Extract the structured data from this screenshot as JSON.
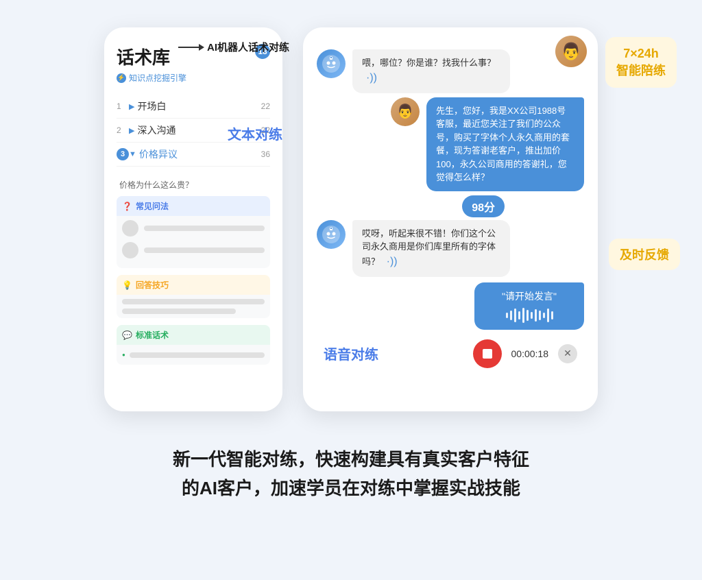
{
  "page": {
    "bg_color": "#f0f4fa"
  },
  "arrow_label": "AI机器人话术对练",
  "phone_left": {
    "title": "话术库",
    "subtitle": "知识点挖掘引擎",
    "badge_count": "18",
    "menu_items": [
      {
        "num": "1",
        "arrow": "▶",
        "label": "开场白",
        "count": "22",
        "active": false
      },
      {
        "num": "2",
        "arrow": "▶",
        "label": "深入沟通",
        "count": "22",
        "active": false
      },
      {
        "num": "3",
        "arrow": "▼",
        "label": "价格异议",
        "count": "36",
        "active": true
      }
    ],
    "sub_question": "价格为什么这么贵？",
    "sections": [
      {
        "type": "faq",
        "icon": "❓",
        "label": "常见问法",
        "color": "blue"
      },
      {
        "type": "tips",
        "icon": "💡",
        "label": "回答技巧",
        "color": "orange"
      },
      {
        "type": "std",
        "icon": "💬",
        "label": "标准话术",
        "color": "green"
      }
    ]
  },
  "phone_right": {
    "header": "AI机器人话术对练",
    "messages": [
      {
        "type": "bot",
        "text": "喂，哪位？你是谁？找我什么事？",
        "has_sound": true
      },
      {
        "type": "user",
        "text": "先生，您好，我是XX公司1988号客服，最近您关注了我们的公众号，购买了字体个人永久商用的套餐，现为答谢老客户，推出加价100，永久公司商用的答谢礼，您觉得怎么样？",
        "has_sound": false
      },
      {
        "type": "bot",
        "text": "哎呀，听起来很不错！你们这个公司永久商用是你们库里所有的字体吗？",
        "has_sound": true
      },
      {
        "type": "voice",
        "text": "\"请开始发言\""
      }
    ],
    "score": "98分",
    "timer": "00:00:18",
    "text_practice_label": "文本对练",
    "voice_practice_label": "语音对练",
    "side_label_top": "7×24h\n智能陪练",
    "side_label_mid": "及时反馈"
  },
  "bottom_text": {
    "line1": "新一代智能对练，快速构建具有真实客户特征",
    "line2": "的AI客户，加速学员在对练中掌握实战技能"
  },
  "icons": {
    "bot_face": "🤖",
    "user_face": "👨",
    "sound_bars": "·))"
  }
}
